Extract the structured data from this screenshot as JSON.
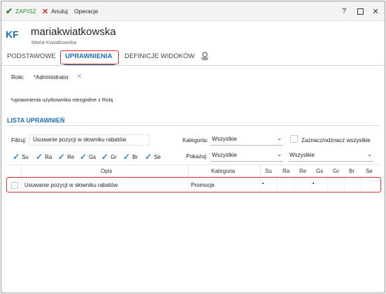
{
  "toolbar": {
    "save_label": "ZAPISZ",
    "cancel_label": "Anuluj",
    "operations_label": "Operacje",
    "help": "?"
  },
  "user": {
    "initials": "KF",
    "login": "mariakwiatkowska",
    "full_name": "Maria Kwiatkowska"
  },
  "tabs": [
    {
      "label": "PODSTAWOWE",
      "active": false
    },
    {
      "label": "UPRAWNIENIA",
      "active": true
    },
    {
      "label": "DEFINICJE WIDOKÓW",
      "active": false
    }
  ],
  "role": {
    "label": "Role:",
    "value": "*Administrator"
  },
  "note": "*uprawnienia użytkownika niezgodne z Rolą",
  "section_title": "LISTA UPRAWNIEŃ",
  "filters": {
    "filter_label": "Filtruj:",
    "filter_value": "Usuwanie pozycji w słowniku rabatów",
    "category_label": "Kategoria:",
    "category_value": "Wszystkie",
    "toggle_all_label": "Zaznacz/odznacz wszystkie",
    "show_label": "Pokazuj:",
    "show_value": "Wszystkie",
    "show_value2": "Wszystkie"
  },
  "days": [
    "Su",
    "Ra",
    "Re",
    "Gs",
    "Gr",
    "Br",
    "Se"
  ],
  "table": {
    "headers": {
      "desc": "Opis",
      "category": "Kategoria",
      "days": [
        "Su",
        "Ra",
        "Re",
        "Gs",
        "Gr",
        "Br",
        "Se"
      ]
    },
    "rows": [
      {
        "desc": "Usuwanie pozycji w słowniku rabatów",
        "category": "Promocje",
        "marks": [
          true,
          false,
          false,
          true,
          false,
          false,
          false
        ]
      }
    ]
  },
  "colors": {
    "accent": "#1e6fb4",
    "highlight": "#e0312e",
    "save_green": "#2f8a2f",
    "cancel_red": "#d22b2b"
  }
}
